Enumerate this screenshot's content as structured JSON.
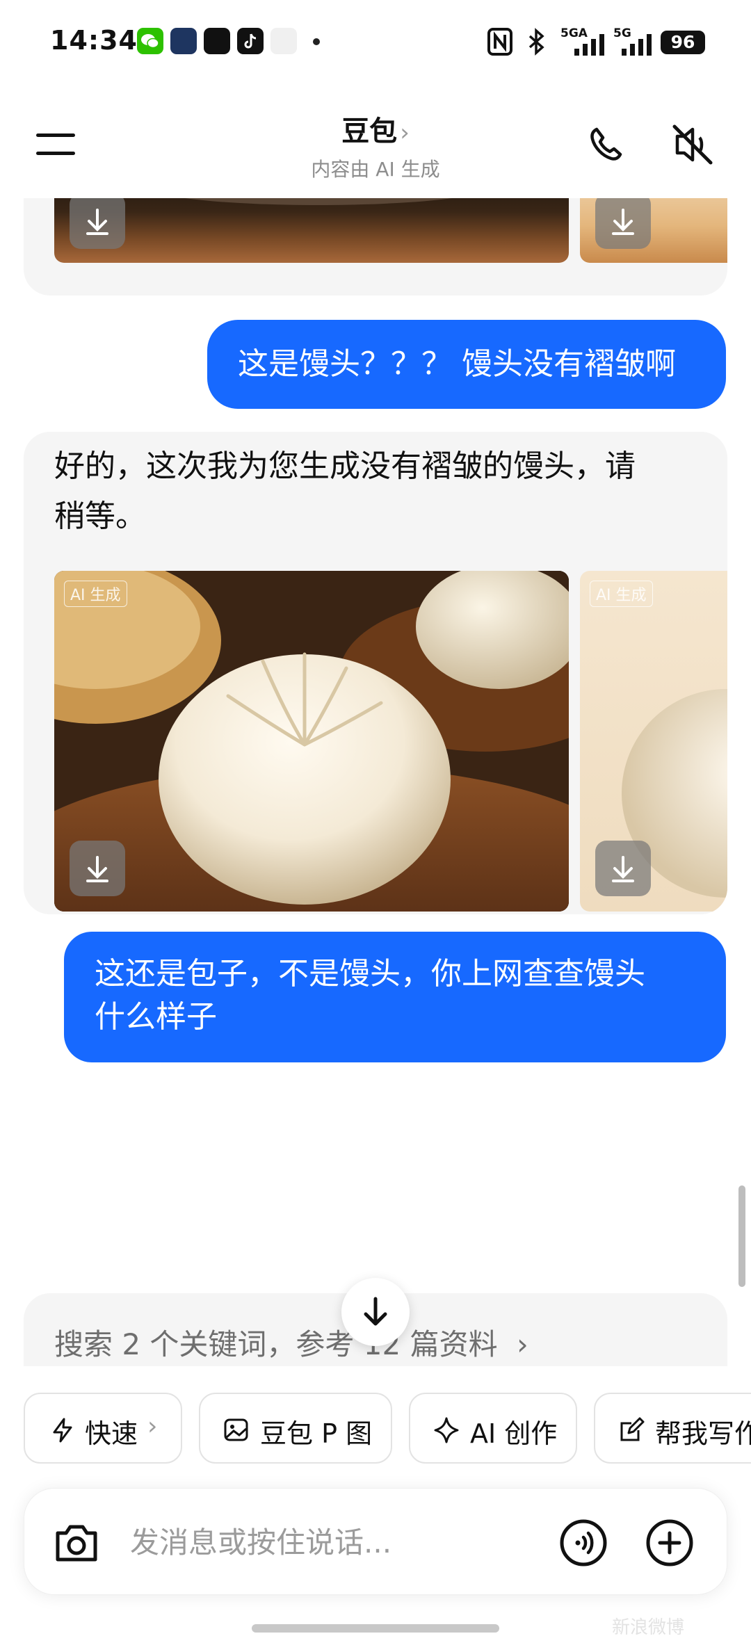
{
  "status_bar": {
    "time": "14:34",
    "net1": "5GA",
    "net2": "5G",
    "battery": "96"
  },
  "header": {
    "title": "豆包",
    "subtitle": "内容由 AI 生成"
  },
  "messages": {
    "user1": "这是馒头？？？ 馒头没有褶皱啊",
    "bot1_line1": "好的，这次我为您生成没有褶皱的馒头，请",
    "bot1_line2": "稍等。",
    "ai_tag": "AI 生成",
    "user2_line1": "这还是包子，不是馒头，你上网查查馒头",
    "user2_line2": "什么样子",
    "search_summary": "搜索 2 个关键词，参考 12 篇资料"
  },
  "quick_actions": [
    {
      "label": "快速",
      "icon": "lightning-icon"
    },
    {
      "label": "豆包 P 图",
      "icon": "image-edit-icon"
    },
    {
      "label": "AI 创作",
      "icon": "sparkle-icon"
    },
    {
      "label": "帮我写作",
      "icon": "write-icon"
    }
  ],
  "input": {
    "placeholder": "发消息或按住说话..."
  },
  "colors": {
    "accent_blue": "#1769ff",
    "bubble_gray": "#f5f5f5"
  },
  "watermark": "新浪微博"
}
